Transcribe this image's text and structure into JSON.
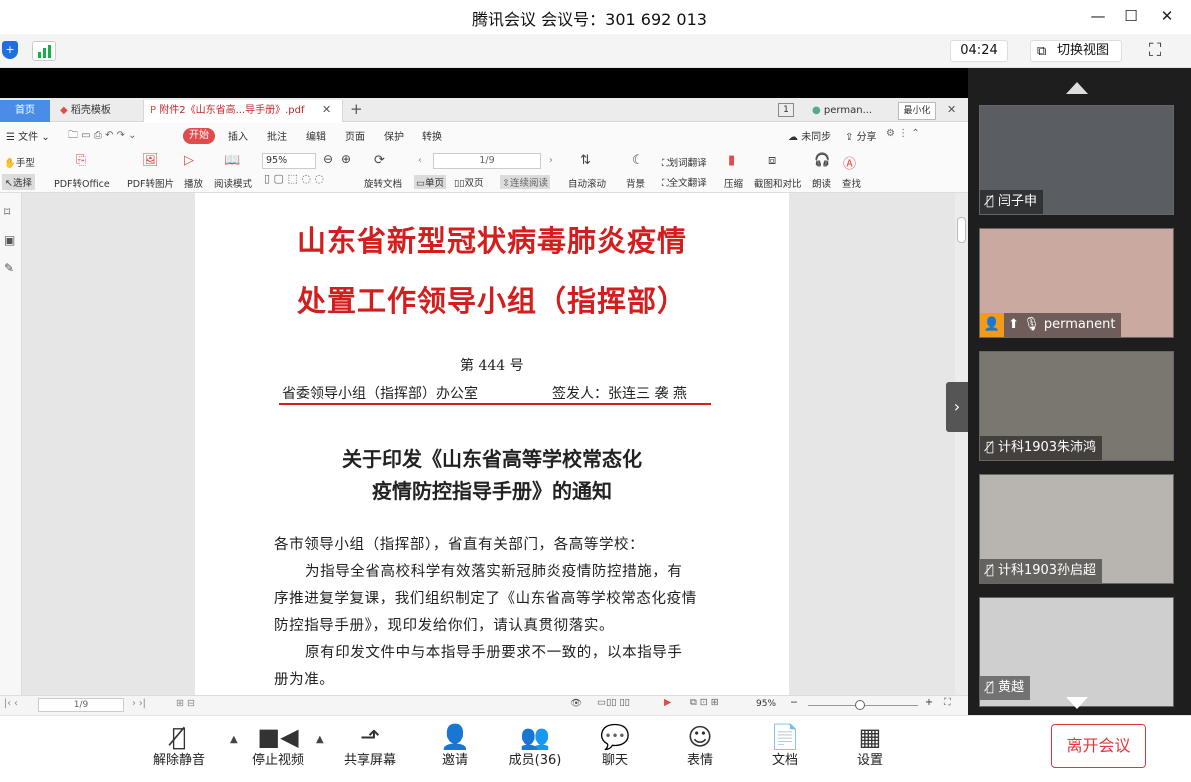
{
  "meeting": {
    "title": "腾讯会议 会议号：301 692 013",
    "timer": "04:24",
    "switch_view": "切换视图"
  },
  "wps": {
    "tabs": [
      {
        "label": "首页"
      },
      {
        "label": "稻壳模板"
      },
      {
        "label": "附件2《山东省高...导手册》.pdf"
      },
      {
        "label": "perman..."
      }
    ],
    "tab_count_badge": "1",
    "minimize_tooltip": "最小化",
    "menu": {
      "file": "文件",
      "start": "开始",
      "insert": "插入",
      "annotate": "批注",
      "edit": "编辑",
      "page": "页面",
      "protect": "保护",
      "convert": "转换",
      "unsync": "未同步",
      "share": "分享"
    },
    "toolbar": {
      "hand": "手型",
      "select": "选择",
      "pdf_to_office": "PDF转Office",
      "pdf_to_image": "PDF转图片",
      "play": "播放",
      "read_mode": "阅读模式",
      "zoom": "95%",
      "rotate": "旋转文档",
      "page_indicator": "1/9",
      "single": "单页",
      "double": "双页",
      "continuous": "连续阅读",
      "auto_scroll": "自动滚动",
      "background": "背景",
      "word_translate": "划词翻译",
      "full_translate": "全文翻译",
      "compress": "压缩",
      "screenshot_compare": "截图和对比",
      "read_aloud": "朗读",
      "find": "查找"
    },
    "status": {
      "page": "1/9",
      "zoom": "95%"
    }
  },
  "doc": {
    "title_line1": "山东省新型冠状病毒肺炎疫情",
    "title_line2": "处置工作领导小组（指挥部）",
    "number": "第 444 号",
    "issuer_left": "省委领导小组（指挥部）办公室",
    "issuer_right": "签发人：张连三  袭 燕",
    "notice_line1": "关于印发《山东省高等学校常态化",
    "notice_line2": "疫情防控指导手册》的通知",
    "salutation": "各市领导小组（指挥部），省直有关部门，各高等学校：",
    "para1_line1": "为指导全省高校科学有效落实新冠肺炎疫情防控措施，有",
    "para1_line2": "序推进复学复课，我们组织制定了《山东省高等学校常态化疫情",
    "para1_line3": "防控指导手册》，现印发给你们，请认真贯彻落实。",
    "para2_line1": "原有印发文件中与本指导手册要求不一致的，以本指导手",
    "para2_line2": "册为准。"
  },
  "participants": [
    {
      "name": "闫子申",
      "muted": true,
      "bg": "#5a5e62"
    },
    {
      "name": "permanent",
      "muted": false,
      "bg": "#c9a9a0"
    },
    {
      "name": "计科1903朱沛鸿",
      "muted": true,
      "bg": "#7a7670"
    },
    {
      "name": "计科1903孙启超",
      "muted": true,
      "bg": "#b8b5b0"
    },
    {
      "name": "黄越",
      "muted": true,
      "bg": "#cfcfcf"
    }
  ],
  "controls": {
    "unmute": "解除静音",
    "stop_video": "停止视频",
    "share_screen": "共享屏幕",
    "invite": "邀请",
    "members": "成员(36)",
    "chat": "聊天",
    "reactions": "表情",
    "docs": "文档",
    "settings": "设置",
    "leave": "离开会议"
  },
  "colors": {
    "accent_red": "#d41e1e",
    "wps_active_tab_blue": "#4a8de8",
    "leave_red": "#e5353b",
    "start_button_red": "#e04b4b"
  }
}
